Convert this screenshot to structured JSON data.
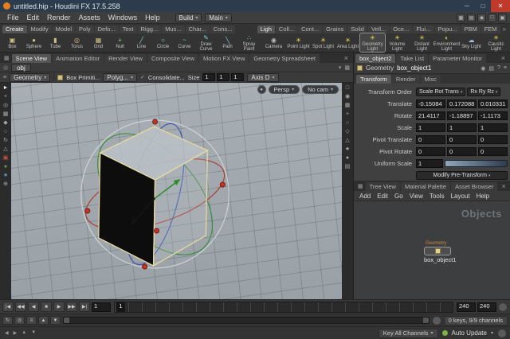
{
  "window": {
    "title": "untitled.hip - Houdini FX 17.5.258"
  },
  "menubar": {
    "items": [
      "File",
      "Edit",
      "Render",
      "Assets",
      "Windows",
      "Help"
    ],
    "desktop_build": "Build",
    "desktop_main": "Main"
  },
  "shelf": {
    "tabs_left": [
      "Create",
      "Modify",
      "Model",
      "Poly",
      "Defo...",
      "Text",
      "Rigg...",
      "Mus...",
      "Char...",
      "Cons..."
    ],
    "tabs_right": [
      "Ligh",
      "Coll...",
      "Cont...",
      "Grains",
      "Solid",
      "Vell...",
      "Oce...",
      "Flui...",
      "Popu...",
      "PBM",
      "FEM"
    ],
    "tools_left": [
      {
        "name": "box",
        "icon": "▣",
        "label": "Box",
        "color": "#cfc083"
      },
      {
        "name": "sphere",
        "icon": "●",
        "label": "Sphere",
        "color": "#cfc083"
      },
      {
        "name": "tube",
        "icon": "▮",
        "label": "Tube",
        "color": "#cfc083"
      },
      {
        "name": "torus",
        "icon": "◎",
        "label": "Torus",
        "color": "#cfc083"
      },
      {
        "name": "grid",
        "icon": "▦",
        "label": "Grid",
        "color": "#cfc083"
      },
      {
        "name": "null",
        "icon": "+",
        "label": "Null",
        "color": "#8fcf8f"
      },
      {
        "name": "line",
        "icon": "╱",
        "label": "Line",
        "color": "#7fd0d0"
      },
      {
        "name": "circle",
        "icon": "○",
        "label": "Circle",
        "color": "#7fd0d0"
      },
      {
        "name": "curve",
        "icon": "~",
        "label": "Curve",
        "color": "#7fd0d0"
      },
      {
        "name": "draw-curve",
        "icon": "✎",
        "label": "Draw Curve",
        "color": "#7fd0d0"
      },
      {
        "name": "path",
        "icon": "╲",
        "label": "Path",
        "color": "#7fd0d0"
      },
      {
        "name": "spray-paint",
        "icon": "∴",
        "label": "Spray Paint",
        "color": "#7fd0d0"
      }
    ],
    "tools_right": [
      {
        "name": "camera",
        "icon": "◉",
        "label": "Camera",
        "color": "#b9b9b9"
      },
      {
        "name": "point-light",
        "icon": "☀",
        "label": "Point Light",
        "color": "#e3cf56"
      },
      {
        "name": "spot-light",
        "icon": "☀",
        "label": "Spot Light",
        "color": "#e3cf56"
      },
      {
        "name": "area-light",
        "icon": "☀",
        "label": "Area Light",
        "color": "#e3cf56"
      },
      {
        "name": "geometry-light",
        "icon": "☀",
        "label": "Geometry Light",
        "color": "#e3cf56"
      },
      {
        "name": "volume-light",
        "icon": "☀",
        "label": "Volume Light",
        "color": "#e3cf56"
      },
      {
        "name": "distant-light",
        "icon": "☀",
        "label": "Distant Light",
        "color": "#e3cf56"
      },
      {
        "name": "environment-light",
        "icon": "◐",
        "label": "Environment Light",
        "color": "#e3cf56"
      },
      {
        "name": "sky-light",
        "icon": "☁",
        "label": "Sky Light",
        "color": "#9fc6e0"
      },
      {
        "name": "caustic-light",
        "icon": "☀",
        "label": "Caustic Light",
        "color": "#e3cf56"
      }
    ]
  },
  "panes": {
    "left_tabs": [
      "Scene View",
      "Animation Editor",
      "Render View",
      "Composite View",
      "Motion FX View",
      "Geometry Spreadsheet"
    ],
    "right_tabs": [
      "box_object2",
      "Take List",
      "Parameter Monitor"
    ]
  },
  "pathbar": {
    "path": "obj"
  },
  "viewport_toolbar": {
    "mode": "Geometry",
    "tool": "Box Primiti...",
    "poly": "Polyg...",
    "consolidate": "Consolidate...",
    "size_label": "Size",
    "size": [
      "1",
      "1",
      "1"
    ],
    "axis": "Axis D"
  },
  "viewport": {
    "persp": "Persp",
    "camera": "No cam"
  },
  "parameters": {
    "type_label": "Geometry",
    "node_name": "box_object1",
    "tabs": [
      "Transform",
      "Render",
      "Misc"
    ],
    "transform_order_label": "Transform Order",
    "transform_order_value": "Scale Rot Trans",
    "rotate_order_value": "Rx Ry Rz",
    "translate_label": "Translate",
    "translate": [
      "-0.15084",
      "0.172088",
      "0.010331"
    ],
    "rotate_label": "Rotate",
    "rotate": [
      "21.4117",
      "-1.18897",
      "-1.1173"
    ],
    "scale_label": "Scale",
    "scale": [
      "1",
      "1",
      "1"
    ],
    "pivot_translate_label": "Pivot Translate",
    "pivot_translate": [
      "0",
      "0",
      "0"
    ],
    "pivot_rotate_label": "Pivot Rotate",
    "pivot_rotate": [
      "0",
      "0",
      "0"
    ],
    "uniform_scale_label": "Uniform Scale",
    "uniform_scale": "1",
    "modify_pretransform": "Modify Pre-Transform"
  },
  "network": {
    "pane_tabs": [
      "Tree View",
      "Material Palette",
      "Asset Browser"
    ],
    "menu": [
      "Add",
      "Edit",
      "Go",
      "View",
      "Tools",
      "Layout",
      "Help"
    ],
    "context_label": "Objects",
    "node_type": "Geometry",
    "node_name": "box_object1"
  },
  "playbar": {
    "current_frame": "1",
    "ruler_first_label": "1",
    "range_end": "240",
    "range_end_alt": "240",
    "keys_info": "0 keys, 9/9 channels",
    "key_all": "Key All Channels",
    "auto_update": "Auto Update"
  },
  "icons": {
    "minimize": "─",
    "maximize": "□",
    "close": "✕",
    "tab_close": "×",
    "pane_lead": "▦",
    "pin": "◎",
    "check": "✓",
    "wrench": "≡",
    "lock": "●",
    "scroll": "»",
    "menubar_right": [
      "▦",
      "▤",
      "◉",
      "□",
      "▣"
    ],
    "left_toolbar": [
      "►",
      "+",
      "◎",
      "▦",
      "◆",
      "○",
      "↻",
      "△",
      "▣",
      "●",
      "★",
      "⊕"
    ],
    "right_toolbar": [
      "□",
      "◉",
      "▦",
      "+",
      "○",
      "◇",
      "△",
      "★",
      "●",
      "▤"
    ],
    "param_header": [
      "◉",
      "▤",
      "?",
      "≡"
    ],
    "pathbar_right": [
      "▾",
      "▦"
    ],
    "transport": [
      "|◀",
      "◀◀",
      "◀",
      "■",
      "▶",
      "▶▶",
      "▶|"
    ],
    "playbar2_left": [
      "↻",
      "◎",
      "≡",
      "▲",
      "▼"
    ],
    "status_left": [
      "◀",
      "▶",
      "▲",
      "▼"
    ]
  },
  "colors": {
    "accent_orange": "#d08b3c",
    "close_red": "#c0392b",
    "auto_update_green": "#7cb342",
    "axis_x_red": "#b03a30",
    "axis_y_green": "#3f8f3f",
    "axis_z_blue": "#3a55b5",
    "node_yellow": "#e3d28e",
    "viewport_bg": "#a0a8ad"
  }
}
